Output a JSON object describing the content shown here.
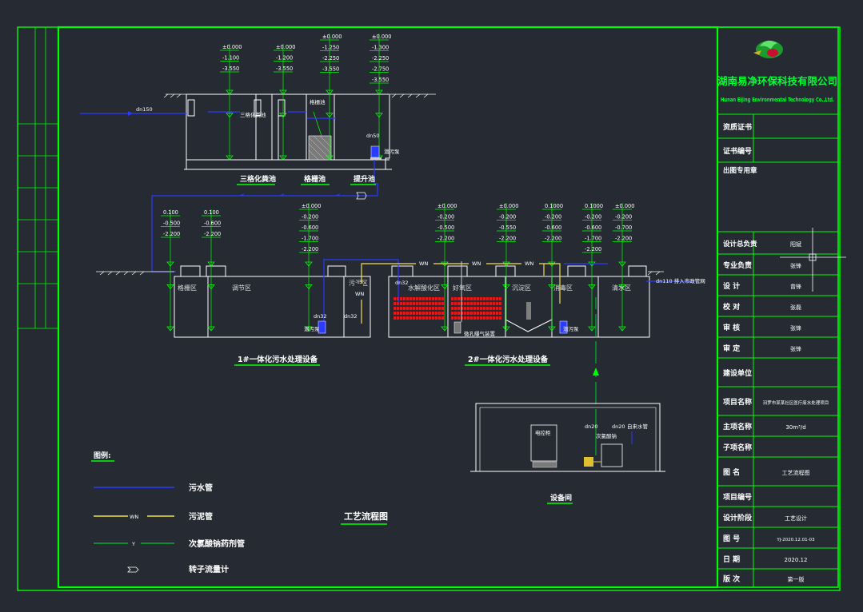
{
  "company": {
    "name_cn": "湖南易净环保科技有限公司",
    "name_en": "Hunan Eijing Environmental Technology Co.,Ltd."
  },
  "titleblock": {
    "rows": [
      {
        "label": "资质证书",
        "value": ""
      },
      {
        "label": "证书编号",
        "value": ""
      },
      {
        "label": "出图专用章",
        "value": ""
      },
      {
        "label": "设计总负责",
        "value": "阳斌"
      },
      {
        "label": "专业负责",
        "value": "张锋"
      },
      {
        "label": "设 计",
        "value": "曾锋"
      },
      {
        "label": "校 对",
        "value": "张磊"
      },
      {
        "label": "审 核",
        "value": "张锋"
      },
      {
        "label": "审 定",
        "value": "张锋"
      },
      {
        "label": "建设单位",
        "value": ""
      },
      {
        "label": "项目名称",
        "value": "汨罗市某某社区医疗废水处理项目"
      },
      {
        "label": "主项名称",
        "value": "30m³/d"
      },
      {
        "label": "子项名称",
        "value": ""
      },
      {
        "label": "图 名",
        "value": "工艺流程图"
      },
      {
        "label": "项目编号",
        "value": ""
      },
      {
        "label": "设计阶段",
        "value": "工艺设计"
      },
      {
        "label": "图 号",
        "value": "YJ-2020.12.01-03"
      },
      {
        "label": "日 期",
        "value": "2020.12"
      },
      {
        "label": "版 次",
        "value": "第一版"
      }
    ]
  },
  "upper_tanks": {
    "elev_groups": [
      [
        "±0.000",
        "-1.100",
        "-3.550"
      ],
      [
        "±0.000",
        "-1.200",
        "-3.550"
      ],
      [
        "±0.000",
        "-1.250",
        "-2.250",
        "-3.550"
      ],
      [
        "±0.000",
        "-1.300",
        "-2.250",
        "-2.750",
        "-3.550"
      ]
    ],
    "labels": {
      "septic_inner": "三格化粪池",
      "grid_inner": "格栅池",
      "septic": "三格化粪池",
      "grid": "格栅池",
      "lift": "提升池",
      "inlet": "dn150",
      "pump_pipe": "dn50",
      "pump": "潜污泵"
    }
  },
  "lower": {
    "elev_groups": [
      [
        "0.100",
        "-0.500",
        "-2.200"
      ],
      [
        "0.100",
        "-0.600",
        "-2.200"
      ],
      [
        "±0.000",
        "-0.200",
        "-0.600",
        "-1.700",
        "-2.200"
      ],
      [
        "±0.000",
        "-0.200",
        "-0.500",
        "-2.200"
      ],
      [
        "±0.000",
        "-0.200",
        "-0.550",
        "-2.200"
      ],
      [
        "0.1000",
        "-0.200",
        "-0.600",
        "-2.200"
      ],
      [
        "0.1000",
        "-0.200",
        "-0.600",
        "-1.700",
        "-2.200"
      ],
      [
        "±0.000",
        "-0.200",
        "-0.700",
        "-2.200"
      ]
    ],
    "zones": {
      "grid": "格栅区",
      "adjust": "调节区",
      "sludge": "污泥区",
      "hydrolysis": "水解酸化区",
      "aerobic": "好氧区",
      "settle": "沉淀区",
      "disinfect": "消毒区",
      "clear": "清水区"
    },
    "pipe_labels": {
      "dn32a": "dn32",
      "dn32b": "dn32",
      "dn32c": "dn32",
      "outlet": "dn110 排入市政管网",
      "pump1": "潜污泵",
      "pump2": "潜污泵",
      "aeration": "微孔曝气装置",
      "wn": "WN"
    },
    "unit1": "1#一体化污水处理设备",
    "unit2": "2#一体化污水处理设备"
  },
  "equipment_room": {
    "title": "设备间",
    "cabinet": "电控柜",
    "dn20a": "dn20",
    "dn20b": "dn20",
    "tap": "自来水管",
    "dosing": "次氯酸钠"
  },
  "legend": {
    "title": "图例:",
    "items": [
      {
        "label": "污水管",
        "symbol": ""
      },
      {
        "label": "污泥管",
        "symbol": "WN"
      },
      {
        "label": "次氯酸钠药剂管",
        "symbol": "Y"
      },
      {
        "label": "转子流量计",
        "symbol": ""
      }
    ]
  },
  "drawing_title": "工艺流程图",
  "colors": {
    "frame": "#00ff00",
    "sewage": "#2a3cff",
    "sludge": "#f5e050",
    "chem": "#00cc33",
    "struct": "#ffffff",
    "media": "#e01818",
    "background": "#252a33"
  }
}
